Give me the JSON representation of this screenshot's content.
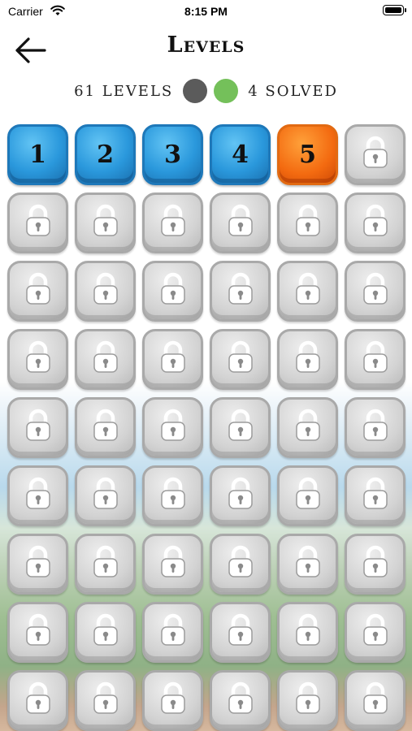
{
  "status_bar": {
    "carrier": "Carrier",
    "time": "8:15 PM"
  },
  "header": {
    "title": "Levels",
    "back_icon": "arrow-left-icon"
  },
  "summary": {
    "levels_text": "61 LEVELS",
    "solved_text": "4 SOLVED",
    "total_color": "#5b5b5b",
    "solved_color": "#74c05a"
  },
  "colors": {
    "solved_tile": "#2a98dc",
    "current_tile": "#f36a10",
    "locked_tile": "#d3d3d3"
  },
  "level_tiles": [
    {
      "label": "1",
      "state": "solved"
    },
    {
      "label": "2",
      "state": "solved"
    },
    {
      "label": "3",
      "state": "solved"
    },
    {
      "label": "4",
      "state": "solved"
    },
    {
      "label": "5",
      "state": "current"
    },
    {
      "label": "",
      "state": "locked"
    },
    {
      "label": "",
      "state": "locked"
    },
    {
      "label": "",
      "state": "locked"
    },
    {
      "label": "",
      "state": "locked"
    },
    {
      "label": "",
      "state": "locked"
    },
    {
      "label": "",
      "state": "locked"
    },
    {
      "label": "",
      "state": "locked"
    },
    {
      "label": "",
      "state": "locked"
    },
    {
      "label": "",
      "state": "locked"
    },
    {
      "label": "",
      "state": "locked"
    },
    {
      "label": "",
      "state": "locked"
    },
    {
      "label": "",
      "state": "locked"
    },
    {
      "label": "",
      "state": "locked"
    },
    {
      "label": "",
      "state": "locked"
    },
    {
      "label": "",
      "state": "locked"
    },
    {
      "label": "",
      "state": "locked"
    },
    {
      "label": "",
      "state": "locked"
    },
    {
      "label": "",
      "state": "locked"
    },
    {
      "label": "",
      "state": "locked"
    },
    {
      "label": "",
      "state": "locked"
    },
    {
      "label": "",
      "state": "locked"
    },
    {
      "label": "",
      "state": "locked"
    },
    {
      "label": "",
      "state": "locked"
    },
    {
      "label": "",
      "state": "locked"
    },
    {
      "label": "",
      "state": "locked"
    },
    {
      "label": "",
      "state": "locked"
    },
    {
      "label": "",
      "state": "locked"
    },
    {
      "label": "",
      "state": "locked"
    },
    {
      "label": "",
      "state": "locked"
    },
    {
      "label": "",
      "state": "locked"
    },
    {
      "label": "",
      "state": "locked"
    },
    {
      "label": "",
      "state": "locked"
    },
    {
      "label": "",
      "state": "locked"
    },
    {
      "label": "",
      "state": "locked"
    },
    {
      "label": "",
      "state": "locked"
    },
    {
      "label": "",
      "state": "locked"
    },
    {
      "label": "",
      "state": "locked"
    },
    {
      "label": "",
      "state": "locked"
    },
    {
      "label": "",
      "state": "locked"
    },
    {
      "label": "",
      "state": "locked"
    },
    {
      "label": "",
      "state": "locked"
    },
    {
      "label": "",
      "state": "locked"
    },
    {
      "label": "",
      "state": "locked"
    },
    {
      "label": "",
      "state": "locked"
    },
    {
      "label": "",
      "state": "locked"
    },
    {
      "label": "",
      "state": "locked"
    },
    {
      "label": "",
      "state": "locked"
    },
    {
      "label": "",
      "state": "locked"
    },
    {
      "label": "",
      "state": "locked"
    }
  ]
}
